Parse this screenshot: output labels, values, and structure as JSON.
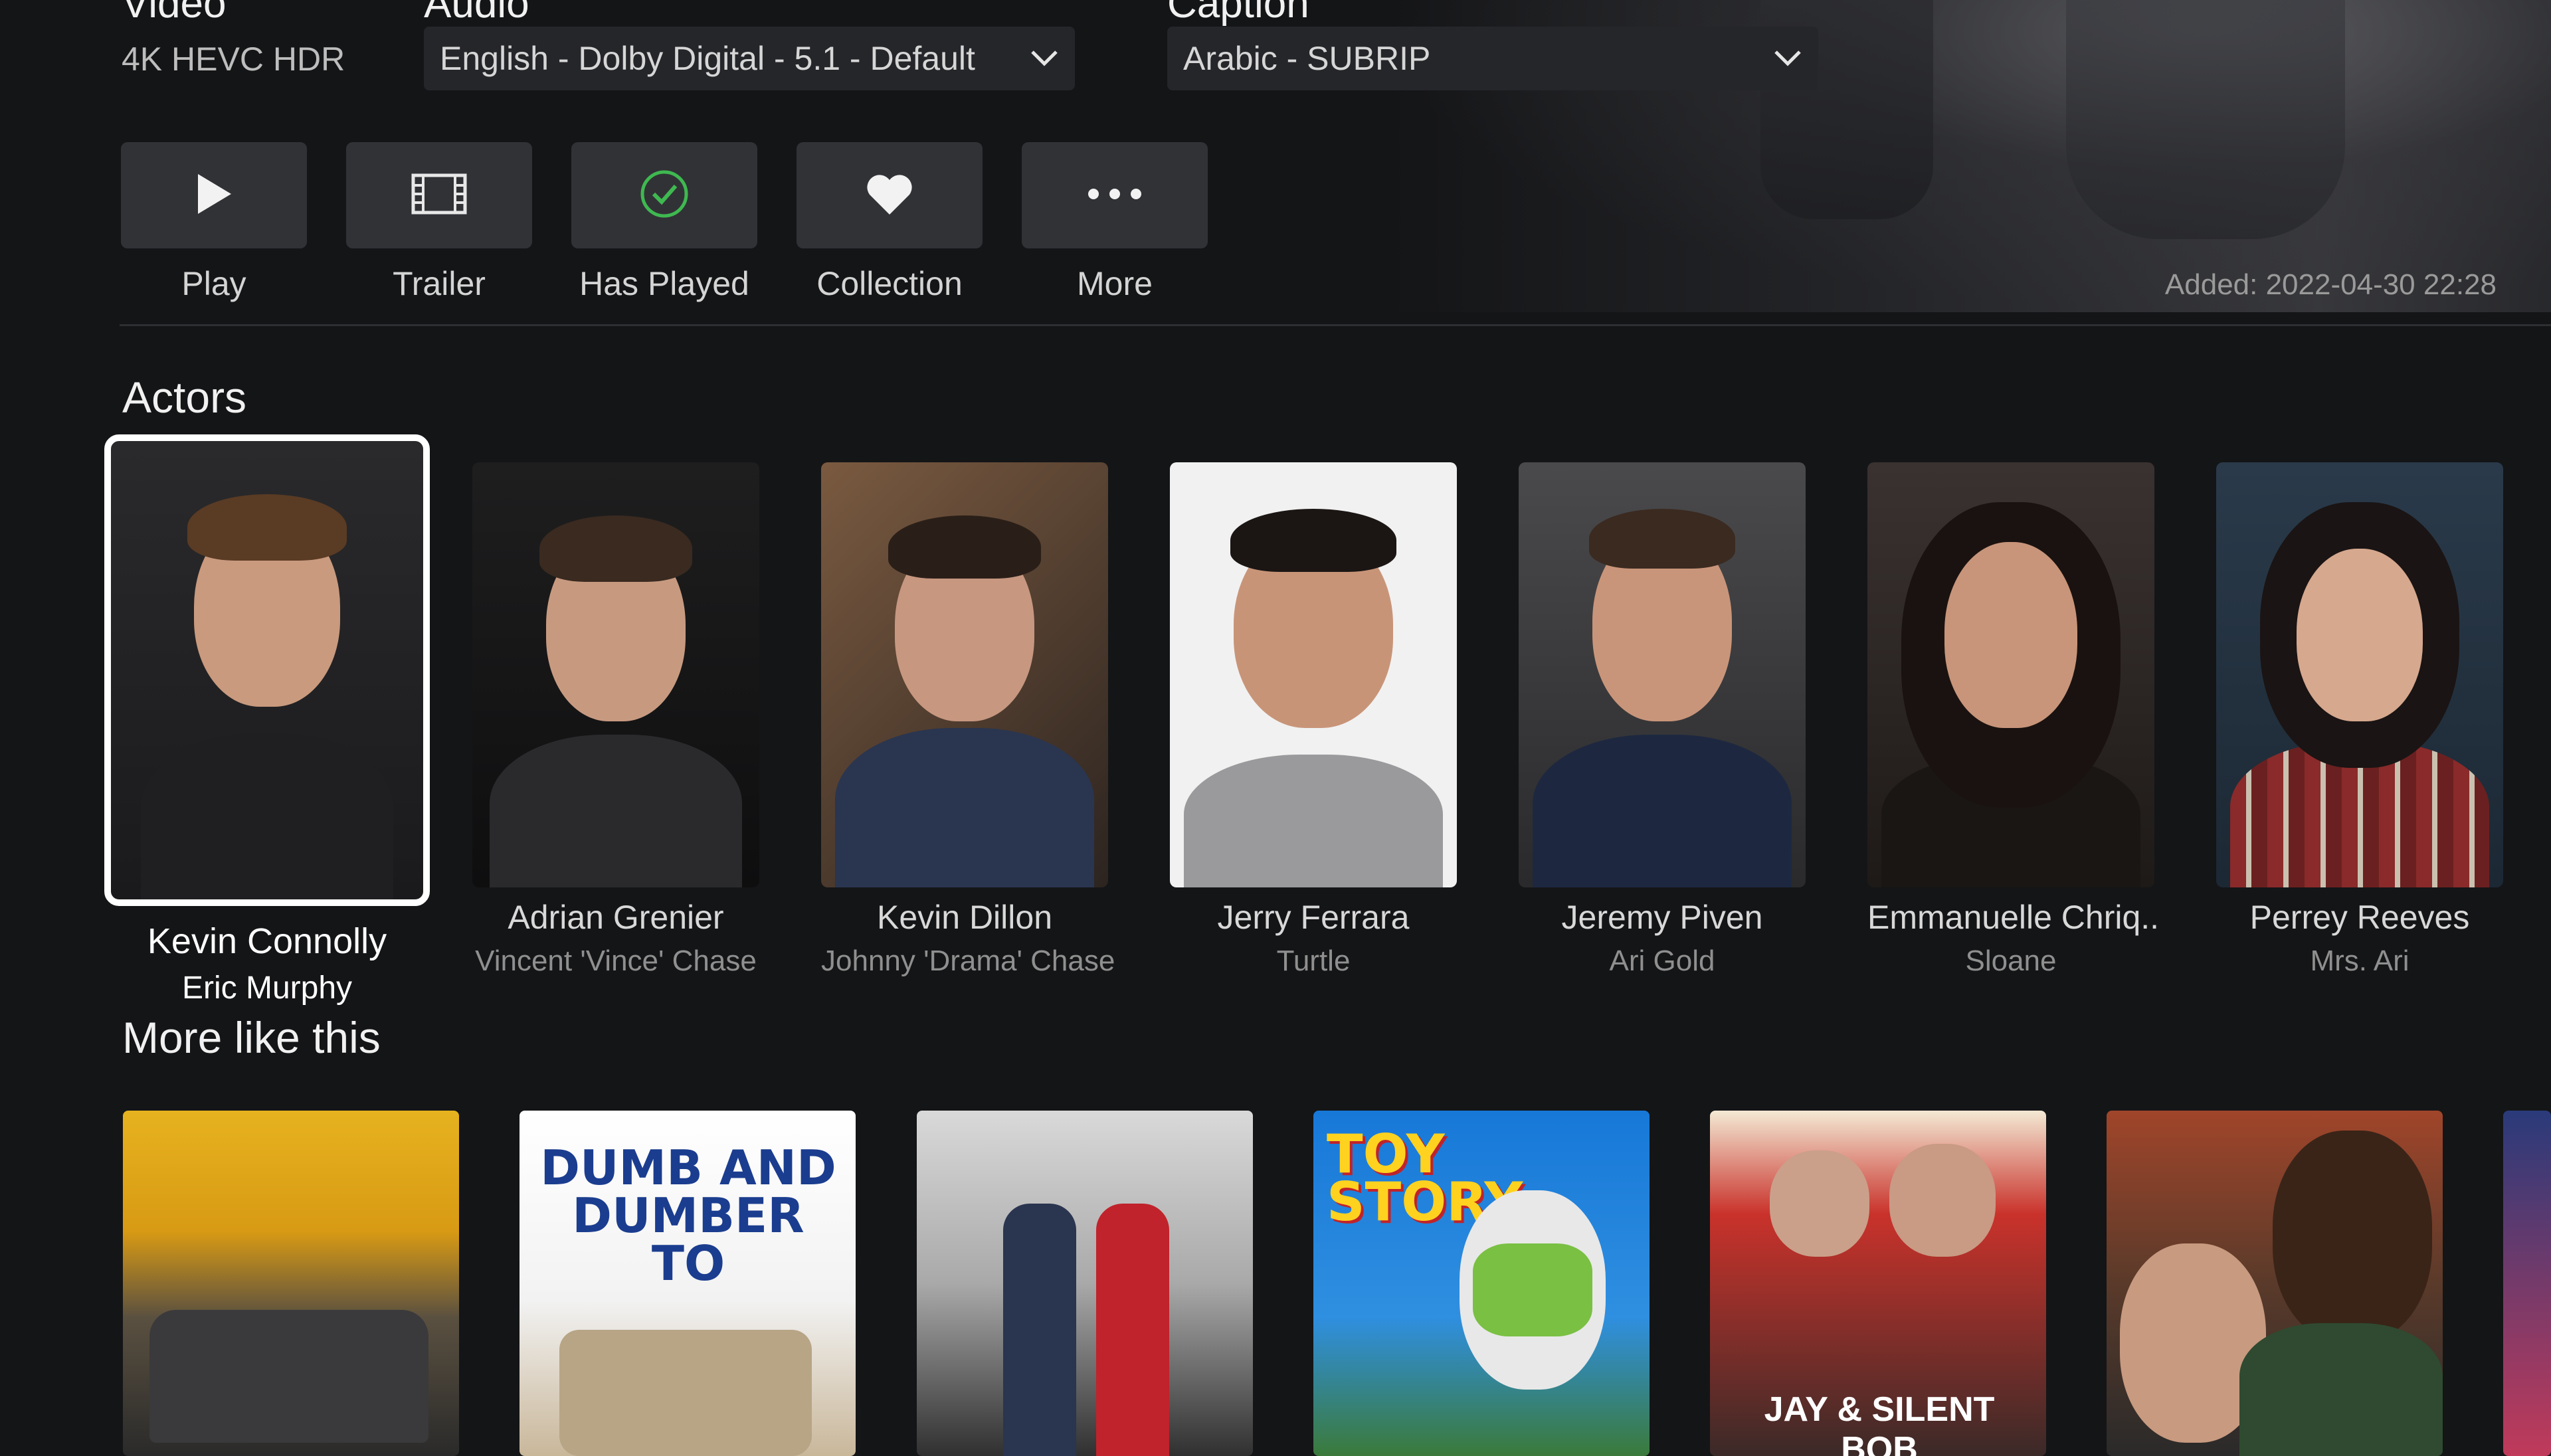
{
  "streams": {
    "video_label": "Video",
    "video_value": "4K HEVC HDR",
    "audio_label": "Audio",
    "audio_value": "English - Dolby Digital - 5.1 - Default",
    "caption_label": "Caption",
    "caption_value": "Arabic - SUBRIP"
  },
  "actions": [
    {
      "label": "Play",
      "icon": "play-icon"
    },
    {
      "label": "Trailer",
      "icon": "film-icon"
    },
    {
      "label": "Has Played",
      "icon": "check-circle-icon"
    },
    {
      "label": "Collection",
      "icon": "heart-icon"
    },
    {
      "label": "More",
      "icon": "more-icon"
    }
  ],
  "added": "Added: 2022-04-30 22:28",
  "actors_title": "Actors",
  "actors": [
    {
      "name": "Kevin Connolly",
      "role": "Eric Murphy"
    },
    {
      "name": "Adrian Grenier",
      "role": "Vincent 'Vince' Chase"
    },
    {
      "name": "Kevin Dillon",
      "role": "Johnny 'Drama' Chase"
    },
    {
      "name": "Jerry Ferrara",
      "role": "Turtle"
    },
    {
      "name": "Jeremy Piven",
      "role": "Ari Gold"
    },
    {
      "name": "Emmanuelle Chriq..",
      "role": "Sloane"
    },
    {
      "name": "Perrey Reeves",
      "role": "Mrs. Ari"
    }
  ],
  "more_title": "More like this",
  "posters": {
    "p2_text": "DUMB AND DUMBER TO",
    "p4_text": "TOY STORY",
    "p5_text": "JAY & SILENT BOB"
  },
  "colors": {
    "accent_check": "#3fb950",
    "background": "#141517",
    "button": "#313236"
  }
}
